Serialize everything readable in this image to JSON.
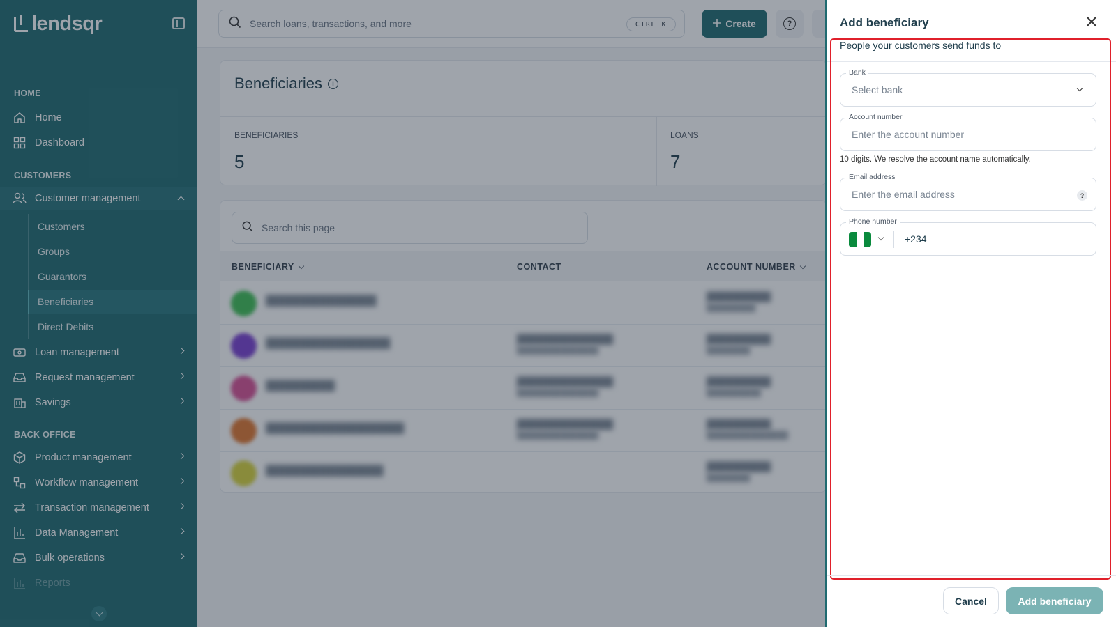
{
  "app": {
    "name": "lendsqr"
  },
  "sidebar": {
    "sections": {
      "home": "HOME",
      "customers": "CUSTOMERS",
      "back_office": "BACK OFFICE"
    },
    "items": {
      "home": "Home",
      "dashboard": "Dashboard",
      "customer_management": "Customer management",
      "customers": "Customers",
      "groups": "Groups",
      "guarantors": "Guarantors",
      "beneficiaries": "Beneficiaries",
      "direct_debits": "Direct Debits",
      "loan_management": "Loan management",
      "request_management": "Request management",
      "savings": "Savings",
      "product_management": "Product management",
      "workflow_management": "Workflow management",
      "transaction_management": "Transaction management",
      "data_management": "Data Management",
      "bulk_operations": "Bulk operations",
      "reports": "Reports"
    }
  },
  "topbar": {
    "search_placeholder": "Search loans, transactions, and more",
    "shortcut": "CTRL K",
    "create_label": "Create",
    "help_glyph": "?"
  },
  "page": {
    "title": "Beneficiaries",
    "info_glyph": "i",
    "stats": [
      {
        "label": "BENEFICIARIES",
        "value": "5"
      },
      {
        "label": "LOANS",
        "value": "7"
      }
    ]
  },
  "table": {
    "search_placeholder": "Search this page",
    "columns": {
      "beneficiary": "BENEFICIARY",
      "contact": "CONTACT",
      "account_number": "ACCOUNT NUMBER"
    },
    "avatar_colors": [
      "#3fbf54",
      "#7a3fd1",
      "#d84f95",
      "#e0762e",
      "#d8d43a"
    ]
  },
  "drawer": {
    "title": "Add beneficiary",
    "subtitle": "People your customers send funds to",
    "bank": {
      "label": "Bank",
      "placeholder": "Select bank"
    },
    "account_number": {
      "label": "Account number",
      "placeholder": "Enter the account number",
      "hint": "10 digits. We resolve the account name automatically."
    },
    "email": {
      "label": "Email address",
      "placeholder": "Enter the email address",
      "help_glyph": "?"
    },
    "phone": {
      "label": "Phone number",
      "dial_code": "+234",
      "flag_colors": [
        "#0a8a3d",
        "#ffffff",
        "#0a8a3d"
      ]
    },
    "cancel_label": "Cancel",
    "submit_label": "Add beneficiary"
  },
  "colors": {
    "brand": "#1f6a70",
    "highlight": "#e0202b",
    "submit_disabled": "#7bb3b4"
  }
}
